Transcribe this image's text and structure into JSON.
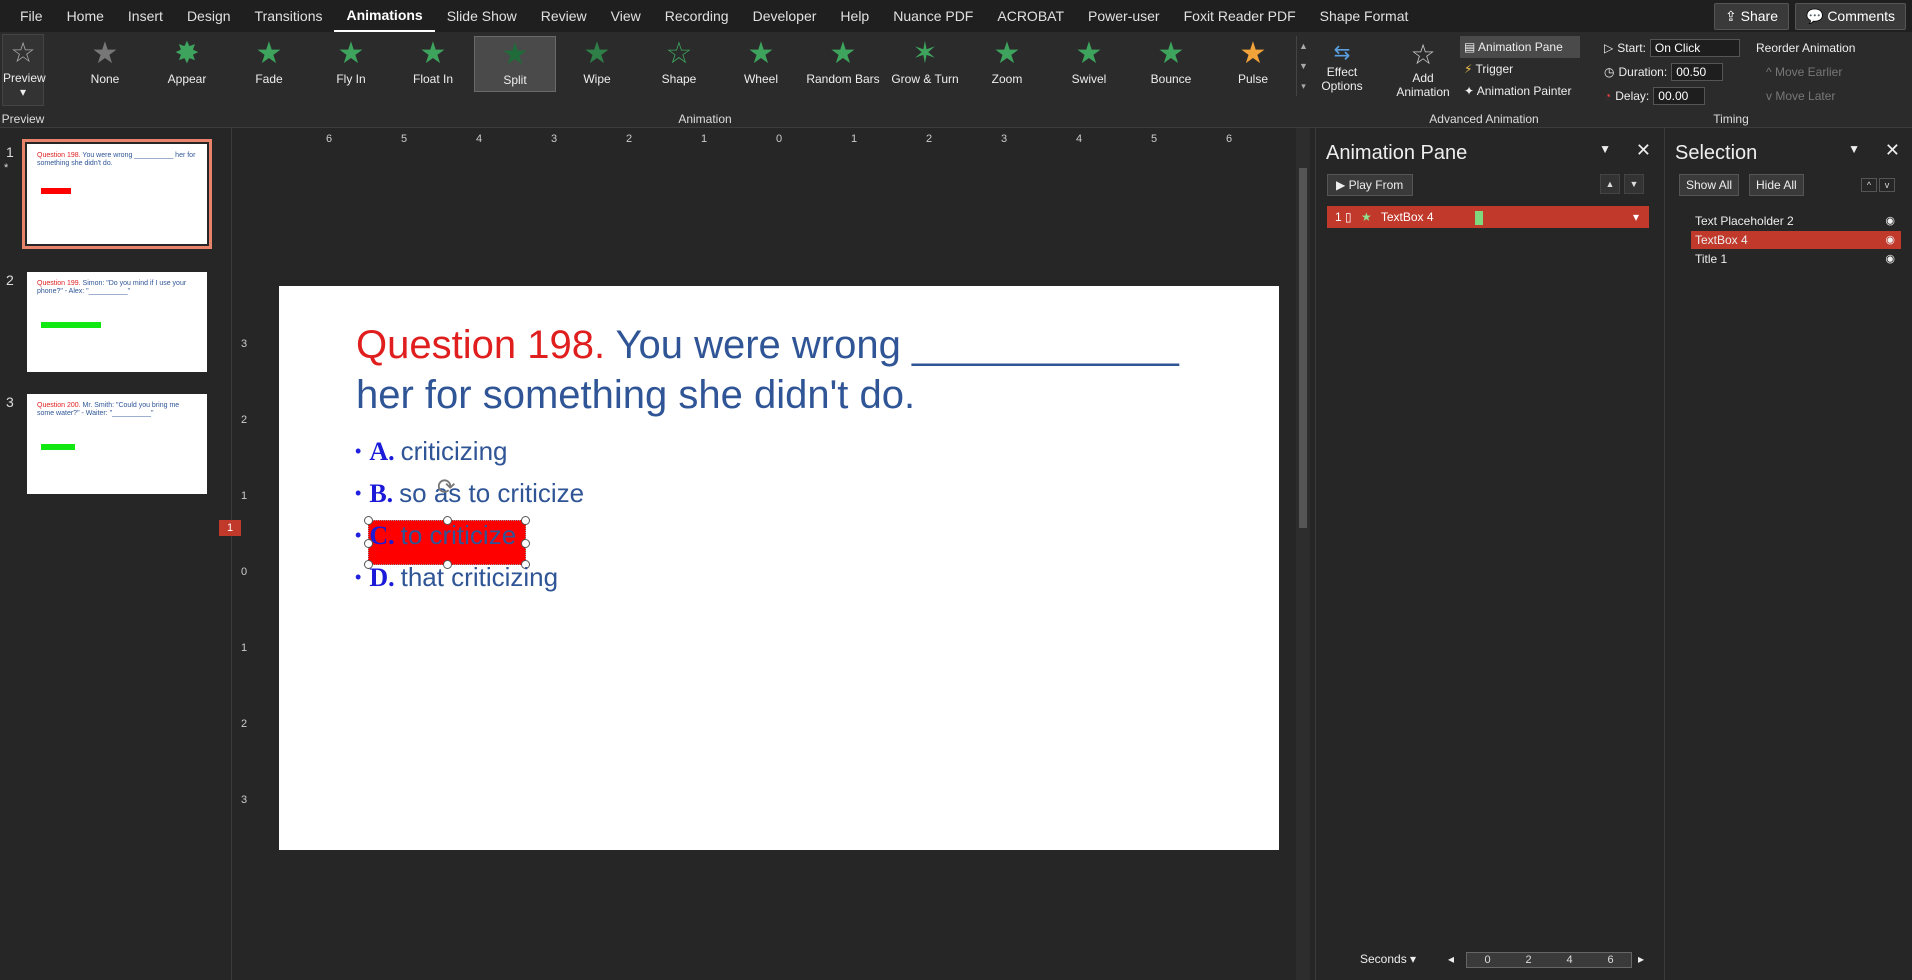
{
  "menu": {
    "tabs": [
      "File",
      "Home",
      "Insert",
      "Design",
      "Transitions",
      "Animations",
      "Slide Show",
      "Review",
      "View",
      "Recording",
      "Developer",
      "Help",
      "Nuance PDF",
      "ACROBAT",
      "Power-user",
      "Foxit Reader PDF",
      "Shape Format"
    ],
    "active_tab": "Animations",
    "share_label": "Share",
    "comments_label": "Comments"
  },
  "ribbon": {
    "preview_label": "Preview",
    "preview_group": "Preview",
    "animation_group": "Animation",
    "animations": [
      "None",
      "Appear",
      "Fade",
      "Fly In",
      "Float In",
      "Split",
      "Wipe",
      "Shape",
      "Wheel",
      "Random Bars",
      "Grow & Turn",
      "Zoom",
      "Swivel",
      "Bounce",
      "Pulse"
    ],
    "selected_animation": "Split",
    "effect_options_label": "Effect Options",
    "add_animation_label": "Add Animation",
    "animation_pane_label": "Animation Pane",
    "trigger_label": "Trigger",
    "animation_painter_label": "Animation Painter",
    "advanced_group": "Advanced Animation",
    "timing_group": "Timing",
    "start_label": "Start:",
    "start_value": "On Click",
    "duration_label": "Duration:",
    "duration_value": "00.50",
    "delay_label": "Delay:",
    "delay_value": "00.00",
    "reorder_label": "Reorder Animation",
    "move_earlier": "Move Earlier",
    "move_later": "Move Later"
  },
  "thumbnails": [
    {
      "num": "1",
      "title_red": "Question 198.",
      "title_rest": " You were wrong __________ her for something she didn't do."
    },
    {
      "num": "2",
      "title_red": "Question 199.",
      "title_rest": " Simon: \"Do you mind if I use your phone?\" - Alex: \"__________\""
    },
    {
      "num": "3",
      "title_red": "Question 200.",
      "title_rest": " Mr. Smith: \"Could you bring me some water?\" - Waiter: \"__________\""
    }
  ],
  "ruler": {
    "h": [
      "6",
      "5",
      "4",
      "3",
      "2",
      "1",
      "0",
      "1",
      "2",
      "3",
      "4",
      "5",
      "6"
    ],
    "v": [
      "3",
      "2",
      "1",
      "0",
      "1",
      "2",
      "3"
    ]
  },
  "slide": {
    "question_red": "Question 198.",
    "question_rest": " You were wrong ____________ her for something she didn't do.",
    "options": [
      {
        "letter": "A.",
        "text": "criticizing"
      },
      {
        "letter": "B.",
        "text": "so as to criticize"
      },
      {
        "letter": "C.",
        "text": "to criticize"
      },
      {
        "letter": "D.",
        "text": "that criticizing"
      }
    ],
    "anim_tag": "1"
  },
  "animation_pane": {
    "title": "Animation Pane",
    "play_from": "Play From",
    "item_index": "1",
    "item_name": "TextBox 4",
    "seconds_label": "Seconds",
    "scale": [
      "0",
      "2",
      "4",
      "6"
    ]
  },
  "selection_pane": {
    "title": "Selection",
    "show_all": "Show All",
    "hide_all": "Hide All",
    "items": [
      "Text Placeholder 2",
      "TextBox 4",
      "Title 1"
    ],
    "selected": "TextBox 4"
  },
  "colors": {
    "accent_red": "#c0392b",
    "question_red": "#e01e1e",
    "text_blue": "#2f5596",
    "star_green": "#3da35d"
  }
}
